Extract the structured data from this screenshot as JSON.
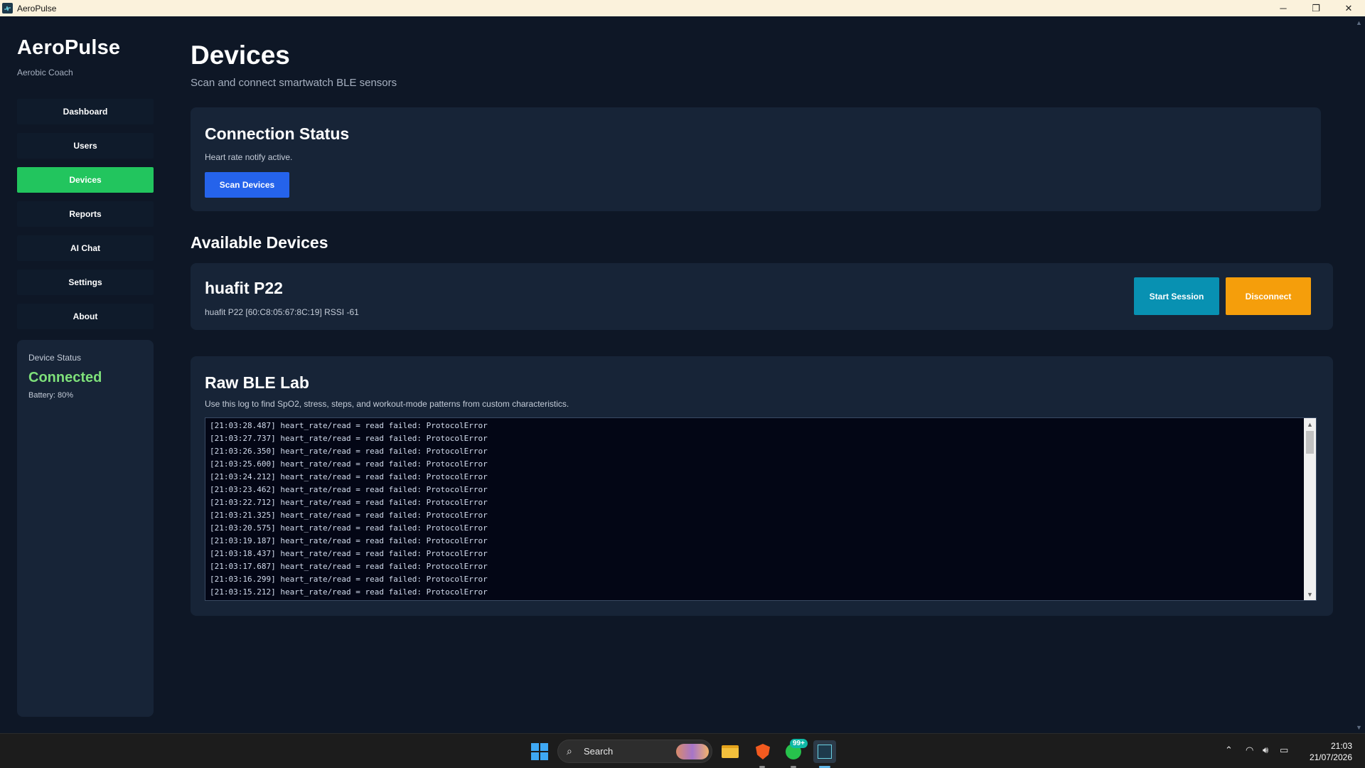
{
  "window": {
    "title": "AeroPulse",
    "controls": {
      "minimize": "─",
      "maximize": "❐",
      "close": "✕"
    }
  },
  "sidebar": {
    "brand": "AeroPulse",
    "brand_sub": "Aerobic Coach",
    "items": [
      {
        "label": "Dashboard",
        "active": false
      },
      {
        "label": "Users",
        "active": false
      },
      {
        "label": "Devices",
        "active": true
      },
      {
        "label": "Reports",
        "active": false
      },
      {
        "label": "AI Chat",
        "active": false
      },
      {
        "label": "Settings",
        "active": false
      },
      {
        "label": "About",
        "active": false
      }
    ],
    "status": {
      "label": "Device Status",
      "value": "Connected",
      "battery": "Battery: 80%"
    }
  },
  "main": {
    "title": "Devices",
    "subtitle": "Scan and connect smartwatch BLE sensors",
    "connection": {
      "title": "Connection Status",
      "message": "Heart rate notify active.",
      "scan_label": "Scan Devices"
    },
    "available_title": "Available Devices",
    "device": {
      "name": "huafit P22",
      "meta": "huafit P22  [60:C8:05:67:8C:19]  RSSI -61",
      "start_label": "Start Session",
      "disconnect_label": "Disconnect"
    },
    "lab": {
      "title": "Raw BLE Lab",
      "subtitle": "Use this log to find SpO2, stress, steps, and workout-mode patterns from custom characteristics.",
      "lines": [
        "[21:03:28.487] heart_rate/read = read failed: ProtocolError",
        "[21:03:27.737] heart_rate/read = read failed: ProtocolError",
        "[21:03:26.350] heart_rate/read = read failed: ProtocolError",
        "[21:03:25.600] heart_rate/read = read failed: ProtocolError",
        "[21:03:24.212] heart_rate/read = read failed: ProtocolError",
        "[21:03:23.462] heart_rate/read = read failed: ProtocolError",
        "[21:03:22.712] heart_rate/read = read failed: ProtocolError",
        "[21:03:21.325] heart_rate/read = read failed: ProtocolError",
        "[21:03:20.575] heart_rate/read = read failed: ProtocolError",
        "[21:03:19.187] heart_rate/read = read failed: ProtocolError",
        "[21:03:18.437] heart_rate/read = read failed: ProtocolError",
        "[21:03:17.687] heart_rate/read = read failed: ProtocolError",
        "[21:03:16.299] heart_rate/read = read failed: ProtocolError",
        "[21:03:15.212] heart_rate/read = read failed: ProtocolError"
      ]
    }
  },
  "taskbar": {
    "search_label": "Search",
    "whatsapp_badge": "99+",
    "time": "21:03",
    "date": "21/07/2026"
  },
  "colors": {
    "background": "#0e1726",
    "card": "#172437",
    "active_nav": "#22c55e",
    "scan_button": "#2563eb",
    "start_button": "#0891b2",
    "disconnect_button": "#f59e0b",
    "connected_text": "#7ee07a"
  }
}
